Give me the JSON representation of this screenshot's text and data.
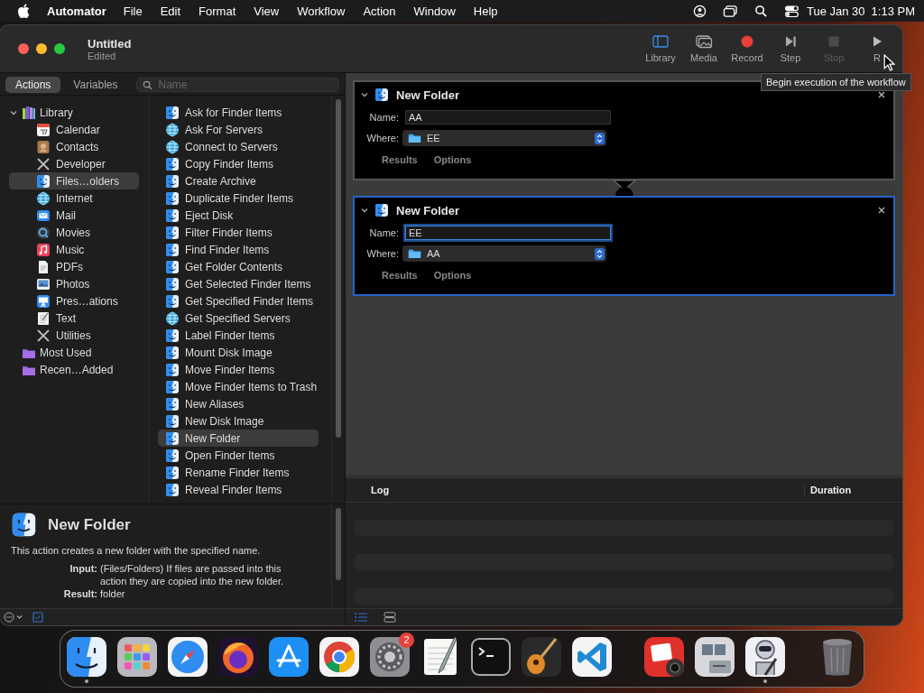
{
  "menubar": {
    "app": "Automator",
    "menus": [
      "File",
      "Edit",
      "Format",
      "View",
      "Workflow",
      "Action",
      "Window",
      "Help"
    ],
    "date": "Tue Jan 30",
    "time": "1:13 PM"
  },
  "window": {
    "title": "Untitled",
    "subtitle": "Edited"
  },
  "toolbar": [
    {
      "label": "Library",
      "kind": "library",
      "on": true,
      "disabled": false
    },
    {
      "label": "Media",
      "kind": "media",
      "disabled": false
    },
    {
      "label": "Record",
      "kind": "record",
      "disabled": false
    },
    {
      "label": "Step",
      "kind": "step",
      "disabled": false
    },
    {
      "label": "Stop",
      "kind": "stop",
      "disabled": true
    },
    {
      "label": "R",
      "kind": "run",
      "disabled": false
    }
  ],
  "tooltip": "Begin execution of the workflow",
  "library_tabs": [
    {
      "label": "Actions",
      "selected": true
    },
    {
      "label": "Variables",
      "selected": false
    }
  ],
  "search": {
    "placeholder": "Name"
  },
  "library_tree": [
    {
      "label": "Library",
      "kind": "library",
      "expanded": true,
      "selected": false,
      "children": [
        {
          "label": "Calendar",
          "kind": "calendar",
          "selected": false
        },
        {
          "label": "Contacts",
          "kind": "contacts",
          "selected": false
        },
        {
          "label": "Developer",
          "kind": "tools",
          "selected": false
        },
        {
          "label": "Files…olders",
          "kind": "finder",
          "selected": true
        },
        {
          "label": "Internet",
          "kind": "globe",
          "selected": false
        },
        {
          "label": "Mail",
          "kind": "mail",
          "selected": false
        },
        {
          "label": "Movies",
          "kind": "movies",
          "selected": false
        },
        {
          "label": "Music",
          "kind": "music",
          "selected": false
        },
        {
          "label": "PDFs",
          "kind": "pdf",
          "selected": false
        },
        {
          "label": "Photos",
          "kind": "photos",
          "selected": false
        },
        {
          "label": "Pres…ations",
          "kind": "presentation",
          "selected": false
        },
        {
          "label": "Text",
          "kind": "text",
          "selected": false
        },
        {
          "label": "Utilities",
          "kind": "tools",
          "selected": false
        }
      ]
    },
    {
      "label": "Most Used",
      "kind": "smart-folder",
      "selected": false
    },
    {
      "label": "Recen…Added",
      "kind": "smart-folder",
      "selected": false
    }
  ],
  "actions": [
    {
      "label": "Ask for Finder Items",
      "kind": "finder",
      "selected": false
    },
    {
      "label": "Ask For Servers",
      "kind": "globe",
      "selected": false
    },
    {
      "label": "Connect to Servers",
      "kind": "globe",
      "selected": false
    },
    {
      "label": "Copy Finder Items",
      "kind": "finder",
      "selected": false
    },
    {
      "label": "Create Archive",
      "kind": "finder",
      "selected": false
    },
    {
      "label": "Duplicate Finder Items",
      "kind": "finder",
      "selected": false
    },
    {
      "label": "Eject Disk",
      "kind": "finder",
      "selected": false
    },
    {
      "label": "Filter Finder Items",
      "kind": "finder",
      "selected": false
    },
    {
      "label": "Find Finder Items",
      "kind": "finder",
      "selected": false
    },
    {
      "label": "Get Folder Contents",
      "kind": "finder",
      "selected": false
    },
    {
      "label": "Get Selected Finder Items",
      "kind": "finder",
      "selected": false
    },
    {
      "label": "Get Specified Finder Items",
      "kind": "finder",
      "selected": false
    },
    {
      "label": "Get Specified Servers",
      "kind": "globe",
      "selected": false
    },
    {
      "label": "Label Finder Items",
      "kind": "finder",
      "selected": false
    },
    {
      "label": "Mount Disk Image",
      "kind": "finder",
      "selected": false
    },
    {
      "label": "Move Finder Items",
      "kind": "finder",
      "selected": false
    },
    {
      "label": "Move Finder Items to Trash",
      "kind": "finder",
      "selected": false
    },
    {
      "label": "New Aliases",
      "kind": "finder",
      "selected": false
    },
    {
      "label": "New Disk Image",
      "kind": "finder",
      "selected": false
    },
    {
      "label": "New Folder",
      "kind": "finder",
      "selected": true
    },
    {
      "label": "Open Finder Items",
      "kind": "finder",
      "selected": false
    },
    {
      "label": "Rename Finder Items",
      "kind": "finder",
      "selected": false
    },
    {
      "label": "Reveal Finder Items",
      "kind": "finder",
      "selected": false
    }
  ],
  "description": {
    "title": "New Folder",
    "text": "This action creates a new folder with the specified name.",
    "input_label": "Input:",
    "input": "(Files/Folders) If files are passed into this action they are copied into the new folder.",
    "result_label": "Result:",
    "result": "folder"
  },
  "workflow": [
    {
      "title": "New Folder",
      "selected": false,
      "name_label": "Name:",
      "name": "AA",
      "where_label": "Where:",
      "where": "EE",
      "tabs": [
        "Results",
        "Options"
      ]
    },
    {
      "title": "New Folder",
      "selected": true,
      "name_label": "Name:",
      "name": "EE",
      "where_label": "Where:",
      "where": "AA",
      "tabs": [
        "Results",
        "Options"
      ]
    }
  ],
  "log": {
    "columns": [
      "Log",
      "Duration"
    ]
  },
  "dock": {
    "apps": [
      {
        "kind": "finder",
        "running": true
      },
      {
        "kind": "launchpad",
        "running": false
      },
      {
        "kind": "safari",
        "running": false
      },
      {
        "kind": "firefox",
        "running": false
      },
      {
        "kind": "appstore",
        "running": false
      },
      {
        "kind": "chrome",
        "running": false
      },
      {
        "kind": "settings",
        "running": false,
        "badge": "2"
      },
      {
        "kind": "textedit",
        "running": false
      },
      {
        "kind": "terminal",
        "running": false
      },
      {
        "kind": "garageband",
        "running": false
      },
      {
        "kind": "vscode",
        "running": false
      }
    ],
    "others": [
      {
        "kind": "photobooth",
        "running": false
      },
      {
        "kind": "drive",
        "running": false
      },
      {
        "kind": "automator",
        "running": true
      }
    ],
    "trash": {
      "kind": "trash",
      "running": false
    }
  }
}
